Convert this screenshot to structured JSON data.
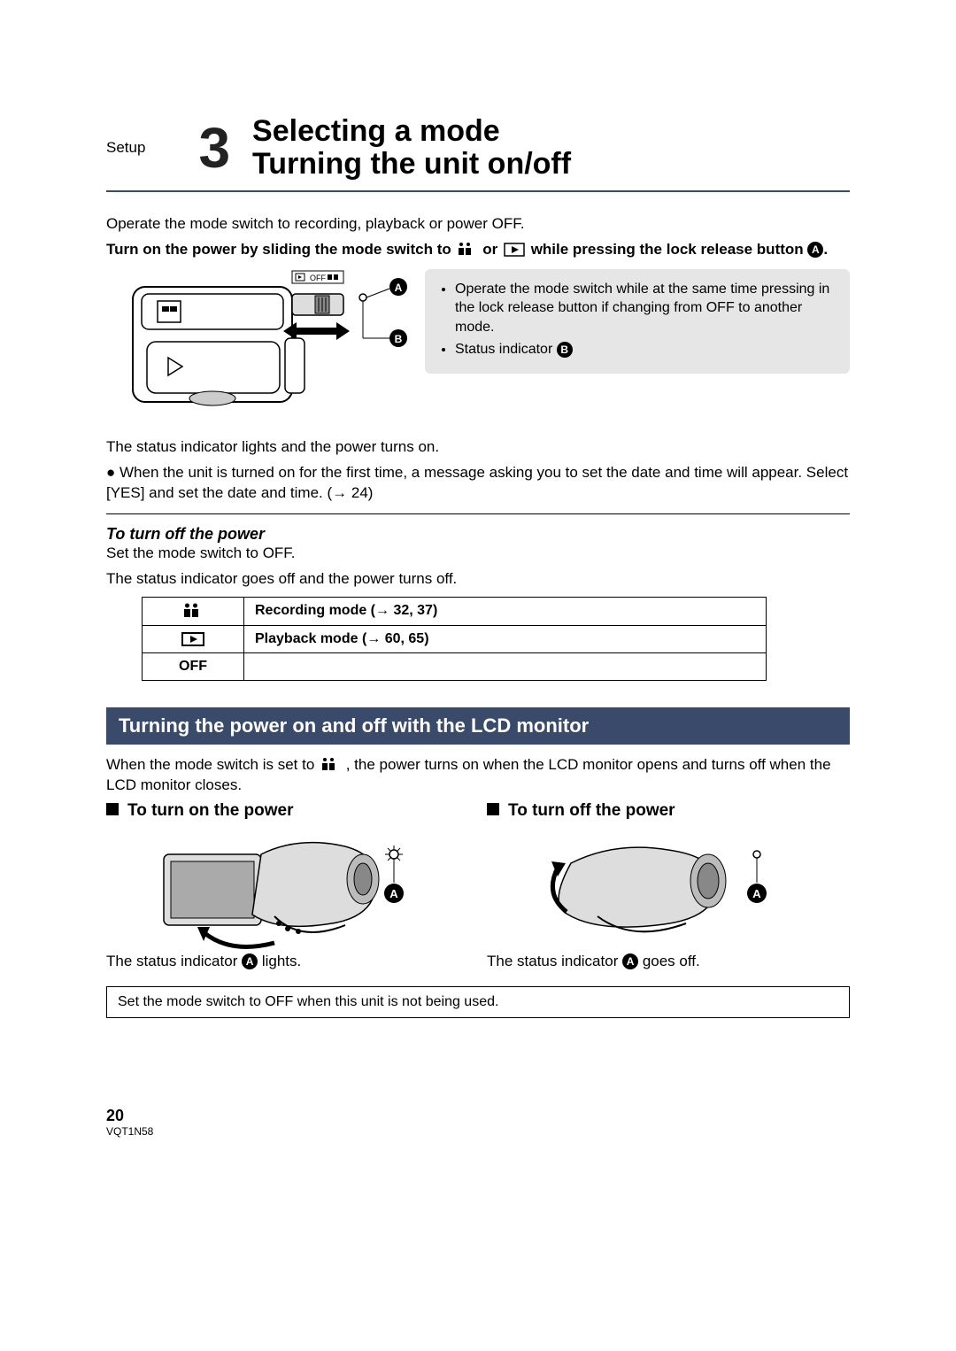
{
  "header": {
    "section_label": "Setup",
    "number": "3",
    "title_line1": "Selecting a mode",
    "title_line2": "Turning the unit on/off"
  },
  "intro_text": "Operate the mode switch to recording, playback or power OFF.",
  "power_on_instruction": {
    "pre": "Turn on the power by sliding the mode switch to ",
    "mid": " or ",
    "post": " while pressing the lock release button ",
    "label_a": "A",
    "period": "."
  },
  "info_box": {
    "bullet1": "Operate the mode switch while at the same time pressing in the lock release button if changing from OFF to another mode.",
    "bullet2_pre": "Status indicator ",
    "bullet2_label": "B"
  },
  "status_text1": "The status indicator lights and the power turns on.",
  "status_text2": "When the unit is turned on for the first time, a message asking you to set the date and time will appear. Select [YES] and set the date and time. (→ 24)",
  "turn_off_heading": "To turn off the power",
  "turn_off_line1": "Set the mode switch to OFF.",
  "turn_off_line2": "The status indicator goes off and the power turns off.",
  "mode_table": {
    "row1": "Recording mode (→ 32, 37)",
    "row2": "Playback mode (→ 60, 65)",
    "row3_label": "OFF",
    "row3_value": ""
  },
  "block_heading": "Turning the power on and off with the LCD monitor",
  "lcd_text": {
    "pre": "When the mode switch is set to ",
    "post": " , the power turns on when the LCD monitor opens and turns off when the LCD monitor closes."
  },
  "col_left": {
    "heading": "To turn on the power",
    "caption_pre": "The status indicator ",
    "caption_label": "A",
    "caption_post": " lights."
  },
  "col_right": {
    "heading": "To turn off the power",
    "caption_pre": "The status indicator ",
    "caption_label": "A",
    "caption_post": " goes off."
  },
  "note_box": "Set the mode switch to OFF when this unit is not being used.",
  "footer": {
    "page": "20",
    "code": "VQT1N58"
  },
  "labels": {
    "A": "A",
    "B": "B"
  },
  "icons": {
    "record": "record-icon",
    "play": "play-icon"
  }
}
